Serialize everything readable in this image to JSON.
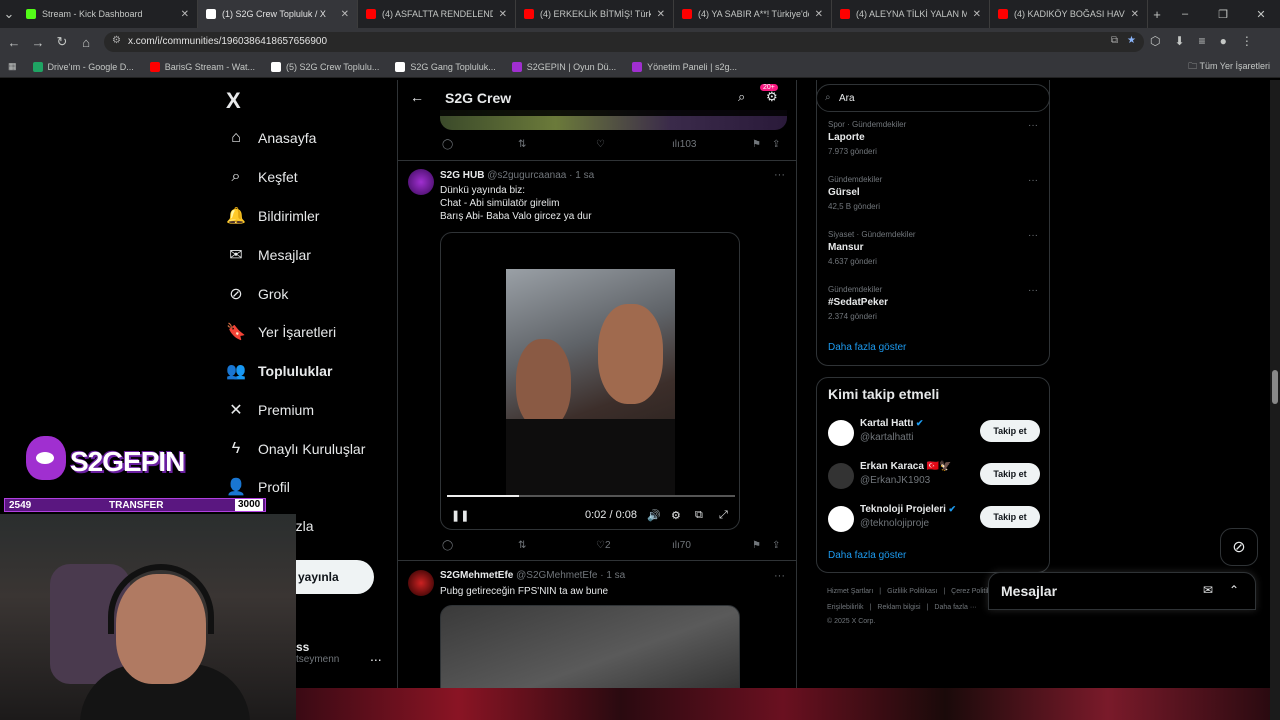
{
  "browser": {
    "tabs": [
      {
        "title": "Stream - Kick Dashboard",
        "color": "#53fc18",
        "active": false
      },
      {
        "title": "(1) S2G Crew Topluluk / X",
        "color": "#ffffff",
        "active": true
      },
      {
        "title": "(4) ASFALTTA RENDELENDİ! Tü",
        "color": "#ff0000",
        "active": false
      },
      {
        "title": "(4) ERKEKLİK BİTMİŞ! Türkiye'd",
        "color": "#ff0000",
        "active": false
      },
      {
        "title": "(4) YA SABIR A**! Türkiye'de Ya",
        "color": "#ff0000",
        "active": false
      },
      {
        "title": "(4) ALEYNA TİLKİ YALAN MAKİN",
        "color": "#ff0000",
        "active": false
      },
      {
        "title": "(4) KADIKÖY BOĞASI HAVUZD",
        "color": "#ff0000",
        "active": false
      }
    ],
    "new_tab": "+",
    "url": "x.com/i/communities/1960386418657656900",
    "bookmarks": [
      {
        "label": "Drive'ım - Google D...",
        "color": "#1fa463"
      },
      {
        "label": "BarisG Stream - Wat...",
        "color": "#ff0000"
      },
      {
        "label": "(5) S2G Crew Toplulu...",
        "color": "#ffffff"
      },
      {
        "label": "S2G Gang Topluluk...",
        "color": "#ffffff"
      },
      {
        "label": "S2GEPIN | Oyun Dü...",
        "color": "#a02fd0"
      },
      {
        "label": "Yönetim Paneli | s2g...",
        "color": "#a02fd0"
      }
    ],
    "all_bookmarks": "Tüm Yer İşaretleri"
  },
  "nav": {
    "logo": "X",
    "items": [
      {
        "label": "Anasayfa",
        "icon": "home-icon",
        "glyph": "⌂"
      },
      {
        "label": "Keşfet",
        "icon": "search-icon",
        "glyph": "⌕"
      },
      {
        "label": "Bildirimler",
        "icon": "bell-icon",
        "glyph": "🔔"
      },
      {
        "label": "Mesajlar",
        "icon": "mail-icon",
        "glyph": "✉"
      },
      {
        "label": "Grok",
        "icon": "grok-icon",
        "glyph": "⊘"
      },
      {
        "label": "Yer İşaretleri",
        "icon": "bookmark-icon",
        "glyph": "🔖"
      },
      {
        "label": "Topluluklar",
        "icon": "communities-icon",
        "glyph": "👥"
      },
      {
        "label": "Premium",
        "icon": "x-premium-icon",
        "glyph": "✕"
      },
      {
        "label": "Onaylı Kuruluşlar",
        "icon": "lightning-icon",
        "glyph": "ϟ"
      },
      {
        "label": "Profil",
        "icon": "profile-icon",
        "glyph": "👤"
      },
      {
        "label": "fazla",
        "icon": "more-icon",
        "glyph": ""
      }
    ],
    "post_button": "yayınla",
    "account_name": "ss",
    "account_handle": "tseymenn",
    "account_more": "..."
  },
  "feed": {
    "title": "S2G Crew",
    "notif_badge": "20+",
    "prev_actions": {
      "views": "103"
    },
    "tweet1": {
      "name": "S2G HUB",
      "handle": "@s2gugurcaanaa",
      "time": "· 1 sa",
      "lines": [
        "Dünkü yayında biz:",
        "Chat - Abi simülatör girelim",
        "Barış Abi- Baba Valo gircez ya dur"
      ],
      "video_time": "0:02 / 0:08",
      "video_progress": 0.25,
      "likes": "2",
      "views": "70"
    },
    "tweet2": {
      "name": "S2GMehmetEfe",
      "handle": "@S2GMehmetEfe",
      "time": "· 1 sa",
      "text": "Pubg getireceğin FPS'NIN ta aw bune"
    }
  },
  "sidebar": {
    "search_placeholder": "Ara",
    "trends": [
      {
        "category": "Spor · Gündemdekiler",
        "title": "Laporte",
        "count": "7.973 gönderi"
      },
      {
        "category": "Gündemdekiler",
        "title": "Gürsel",
        "count": "42,5 B gönderi"
      },
      {
        "category": "Siyaset · Gündemdekiler",
        "title": "Mansur",
        "count": "4.637 gönderi"
      },
      {
        "category": "Gündemdekiler",
        "title": "#SedatPeker",
        "count": "2.374 gönderi"
      }
    ],
    "trends_more": "Daha fazla göster",
    "who_to_follow_title": "Kimi takip etmeli",
    "who_to_follow": [
      {
        "name": "Kartal Hattı",
        "handle": "@kartalhatti",
        "button": "Takip et",
        "color": "#ffffff"
      },
      {
        "name": "Erkan Karaca 🇹🇷🦅",
        "handle": "@ErkanJK1903",
        "button": "Takip et",
        "color": "#333333"
      },
      {
        "name": "Teknoloji Projeleri",
        "handle": "@teknolojiproje",
        "button": "Takip et",
        "color": "#ffffff"
      }
    ],
    "wtf_more": "Daha fazla göster",
    "footer": [
      "Hizmet Şartları",
      "|",
      "Gizlilik Politikası",
      "|",
      "Çerez Politikası",
      "|"
    ],
    "footer2": [
      "Erişilebilirlik",
      "|",
      "Reklam bilgisi",
      "|",
      "Daha fazla ···"
    ],
    "copyright": "© 2025 X Corp."
  },
  "messages_bar": {
    "title": "Mesajlar"
  },
  "stream_overlay": {
    "logo_text": "S2GEPIN",
    "counter_left": "2549",
    "counter_label": "TRANSFER",
    "counter_right": "3000"
  }
}
